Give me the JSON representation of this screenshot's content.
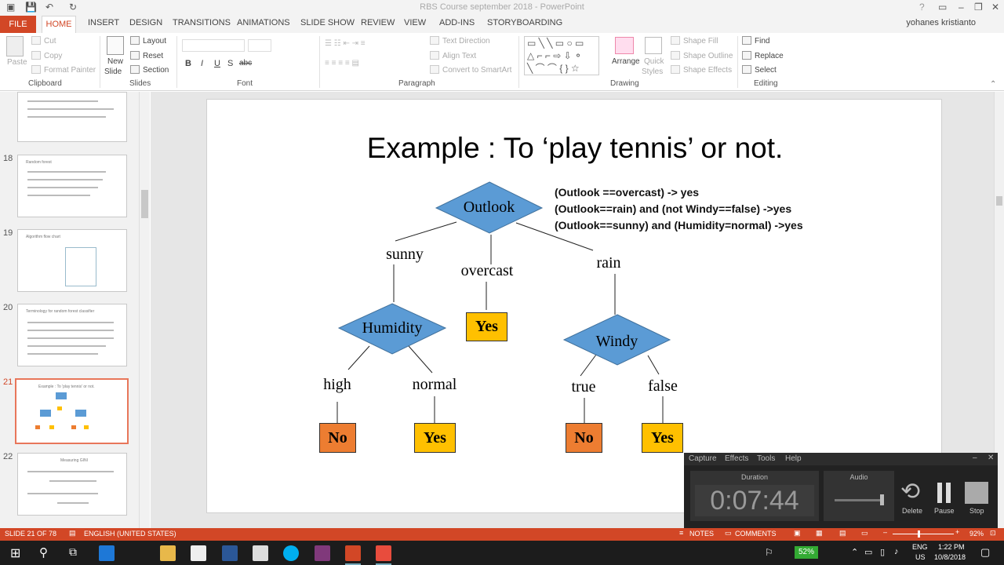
{
  "window": {
    "title": "RBS Course september 2018 - PowerPoint",
    "help": "?",
    "user": "yohanes kristianto"
  },
  "tabs": [
    "FILE",
    "HOME",
    "INSERT",
    "DESIGN",
    "TRANSITIONS",
    "ANIMATIONS",
    "SLIDE SHOW",
    "REVIEW",
    "VIEW",
    "ADD-INS",
    "STORYBOARDING"
  ],
  "ribbon": {
    "clipboard": {
      "label": "Clipboard",
      "paste": "Paste",
      "cut": "Cut",
      "copy": "Copy",
      "format_painter": "Format Painter"
    },
    "slides": {
      "label": "Slides",
      "new_slide": "New",
      "new_slide2": "Slide",
      "layout": "Layout",
      "reset": "Reset",
      "section": "Section"
    },
    "font": {
      "label": "Font",
      "bold": "B",
      "italic": "I",
      "underline": "U",
      "strike": "S",
      "abc": "abc"
    },
    "paragraph": {
      "label": "Paragraph",
      "text_direction": "Text Direction",
      "align_text": "Align Text",
      "smartart": "Convert to SmartArt"
    },
    "drawing": {
      "label": "Drawing",
      "arrange": "Arrange",
      "quick": "Quick",
      "styles": "Styles",
      "shape_fill": "Shape Fill",
      "shape_outline": "Shape Outline",
      "shape_effects": "Shape Effects"
    },
    "editing": {
      "label": "Editing",
      "find": "Find",
      "replace": "Replace",
      "select": "Select"
    }
  },
  "slides_panel": [
    {
      "num": "18",
      "title": "Random forest"
    },
    {
      "num": "19",
      "title": "Algorithm flow chart"
    },
    {
      "num": "20",
      "title": "Terminology for random forest classifier"
    },
    {
      "num": "21",
      "title": "Example : To 'play tennis' or not.",
      "selected": true
    },
    {
      "num": "22",
      "title": "Measuring GINI"
    }
  ],
  "slide": {
    "title": "Example : To ‘play tennis’ or not.",
    "rules": [
      "(Outlook ==overcast)  -> yes",
      "(Outlook==rain) and (not Windy==false) ->yes",
      "(Outlook==sunny) and (Humidity=normal) ->yes"
    ],
    "nodes": {
      "outlook": "Outlook",
      "humidity": "Humidity",
      "windy": "Windy"
    },
    "edges": {
      "sunny": "sunny",
      "overcast": "overcast",
      "rain": "rain",
      "high": "high",
      "normal": "normal",
      "true": "true",
      "false": "false"
    },
    "leaves": {
      "overcast": "Yes",
      "high": "No",
      "normal": "Yes",
      "true": "No",
      "false": "Yes"
    }
  },
  "status": {
    "slide": "SLIDE 21 OF 78",
    "language": "ENGLISH (UNITED STATES)",
    "notes": "NOTES",
    "comments": "COMMENTS",
    "zoom": "92%"
  },
  "recorder": {
    "menu": [
      "Capture",
      "Effects",
      "Tools",
      "Help"
    ],
    "duration_label": "Duration",
    "time": "0:07:44",
    "audio_label": "Audio",
    "delete": "Delete",
    "pause": "Pause",
    "stop": "Stop"
  },
  "taskbar": {
    "battery": "52%",
    "lang1": "ENG",
    "lang2": "US",
    "time": "1:22 PM",
    "date": "10/8/2018"
  },
  "colors": {
    "accent": "#d24726",
    "diamond": "#5b9bd5",
    "yes": "#ffc000",
    "no": "#ed7d31"
  }
}
